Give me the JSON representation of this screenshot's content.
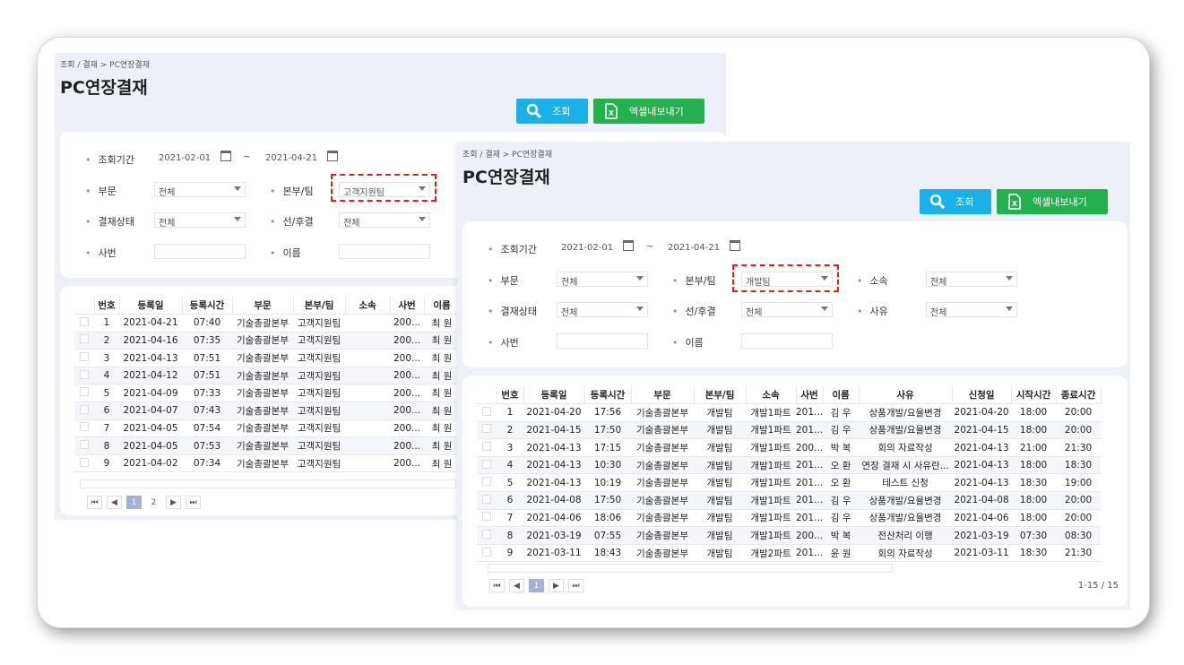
{
  "screen1": {
    "breadcrumb": "조회 / 결재 > PC연장결재",
    "title": "PC연장결재",
    "buttons": {
      "search": "조회",
      "excel": "엑셀내보내기"
    },
    "filters": {
      "period_label": "조회기간",
      "date_from": "2021-02-01",
      "date_to": "2021-04-21",
      "tilde": "~",
      "dept_label": "부문",
      "dept_value": "전체",
      "team_label": "본부/팀",
      "team_value": "고객지원팀",
      "status_label": "결재상태",
      "status_value": "전체",
      "order_label": "선/후결",
      "order_value": "전체",
      "empno_label": "사번",
      "empno_value": "",
      "name_label": "이름",
      "name_value": ""
    },
    "columns": [
      "번호",
      "등록일",
      "등록시간",
      "부문",
      "본부/팀",
      "소속",
      "사번",
      "이름"
    ],
    "rows": [
      [
        "1",
        "2021-04-21",
        "07:40",
        "기술총괄본부",
        "고객지원팀",
        "",
        "200...",
        "최 원"
      ],
      [
        "2",
        "2021-04-16",
        "07:35",
        "기술총괄본부",
        "고객지원팀",
        "",
        "200...",
        "최 원"
      ],
      [
        "3",
        "2021-04-13",
        "07:51",
        "기술총괄본부",
        "고객지원팀",
        "",
        "200...",
        "최 원"
      ],
      [
        "4",
        "2021-04-12",
        "07:51",
        "기술총괄본부",
        "고객지원팀",
        "",
        "200...",
        "최 원"
      ],
      [
        "5",
        "2021-04-09",
        "07:33",
        "기술총괄본부",
        "고객지원팀",
        "",
        "200...",
        "최 원"
      ],
      [
        "6",
        "2021-04-07",
        "07:43",
        "기술총괄본부",
        "고객지원팀",
        "",
        "200...",
        "최 원"
      ],
      [
        "7",
        "2021-04-05",
        "07:54",
        "기술총괄본부",
        "고객지원팀",
        "",
        "200...",
        "최 원"
      ],
      [
        "8",
        "2021-04-05",
        "07:53",
        "기술총괄본부",
        "고객지원팀",
        "",
        "200...",
        "최 원"
      ],
      [
        "9",
        "2021-04-02",
        "07:34",
        "기술총괄본부",
        "고객지원팀",
        "",
        "200...",
        "최 원"
      ]
    ],
    "pager": {
      "first": "⏮",
      "prev": "◀",
      "pages": [
        "1",
        "2"
      ],
      "active_page": "1",
      "next": "▶",
      "last": "⏭"
    }
  },
  "screen2": {
    "breadcrumb": "조회 / 결재 > PC연장결재",
    "title": "PC연장결재",
    "buttons": {
      "search": "조회",
      "excel": "엑셀내보내기"
    },
    "filters": {
      "period_label": "조회기간",
      "date_from": "2021-02-01",
      "date_to": "2021-04-21",
      "tilde": "~",
      "dept_label": "부문",
      "dept_value": "전체",
      "team_label": "본부/팀",
      "team_value": "개발팀",
      "affil_label": "소속",
      "affil_value": "전체",
      "status_label": "결재상태",
      "status_value": "전체",
      "order_label": "선/후결",
      "order_value": "전체",
      "reason_label": "사유",
      "reason_value": "전체",
      "empno_label": "사번",
      "empno_value": "",
      "name_label": "이름",
      "name_value": ""
    },
    "columns": [
      "번호",
      "등록일",
      "등록시간",
      "부문",
      "본부/팀",
      "소속",
      "사번",
      "이름",
      "사유",
      "신청일",
      "시작시간",
      "종료시간"
    ],
    "rows": [
      [
        "1",
        "2021-04-20",
        "17:56",
        "기술총괄본부",
        "개발팀",
        "개발1파트",
        "201...",
        "김 우",
        "상품개발/요율변경",
        "2021-04-20",
        "18:00",
        "20:00"
      ],
      [
        "2",
        "2021-04-15",
        "17:50",
        "기술총괄본부",
        "개발팀",
        "개발1파트",
        "201...",
        "김 우",
        "상품개발/요율변경",
        "2021-04-15",
        "18:00",
        "20:00"
      ],
      [
        "3",
        "2021-04-13",
        "17:15",
        "기술총괄본부",
        "개발팀",
        "개발1파트",
        "200...",
        "박 복",
        "회의 자료작성",
        "2021-04-13",
        "21:00",
        "21:30"
      ],
      [
        "4",
        "2021-04-13",
        "10:30",
        "기술총괄본부",
        "개발팀",
        "개발1파트",
        "201...",
        "오 환",
        "연장 결재 시 사유란...",
        "2021-04-13",
        "18:00",
        "18:30"
      ],
      [
        "5",
        "2021-04-13",
        "10:19",
        "기술총괄본부",
        "개발팀",
        "개발1파트",
        "201...",
        "오 환",
        "테스트 신청",
        "2021-04-13",
        "18:30",
        "19:00"
      ],
      [
        "6",
        "2021-04-08",
        "17:50",
        "기술총괄본부",
        "개발팀",
        "개발1파트",
        "201...",
        "김 우",
        "상품개발/요율변경",
        "2021-04-08",
        "18:00",
        "20:00"
      ],
      [
        "7",
        "2021-04-06",
        "18:06",
        "기술총괄본부",
        "개발팀",
        "개발1파트",
        "201...",
        "김 우",
        "상품개발/요율변경",
        "2021-04-06",
        "18:00",
        "20:00"
      ],
      [
        "8",
        "2021-03-19",
        "07:55",
        "기술총괄본부",
        "개발팀",
        "개발1파트",
        "200...",
        "박 복",
        "전산처리 이행",
        "2021-03-19",
        "07:30",
        "08:30"
      ],
      [
        "9",
        "2021-03-11",
        "18:43",
        "기술총괄본부",
        "개발팀",
        "개발2파트",
        "201...",
        "윤 원",
        "회의 자료작성",
        "2021-03-11",
        "18:30",
        "21:30"
      ]
    ],
    "pager": {
      "first": "⏮",
      "prev": "◀",
      "pages": [
        "1"
      ],
      "active_page": "1",
      "next": "▶",
      "last": "⏭"
    },
    "count": "1-15 / 15"
  },
  "colors": {
    "search_button": "#18b2e8",
    "excel_button": "#22b14c",
    "highlight": "#e02020",
    "panel_bg": "#eef0f7",
    "active_page": "#a5b1d8"
  }
}
